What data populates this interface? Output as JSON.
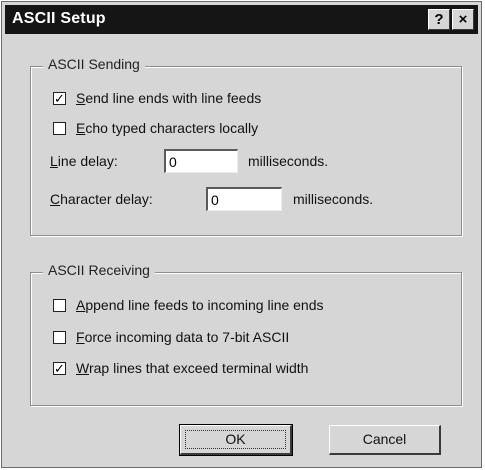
{
  "window": {
    "title": "ASCII Setup",
    "help_glyph": "?",
    "close_glyph": "×"
  },
  "sending": {
    "legend": "ASCII Sending",
    "line_feeds": {
      "hotkey": "S",
      "label_rest": "end line ends with line feeds",
      "checked": true
    },
    "echo": {
      "hotkey": "E",
      "label_rest": "cho typed characters locally",
      "checked": false
    },
    "line_delay": {
      "hotkey": "L",
      "label_rest": "ine delay:",
      "value": "0",
      "unit": "milliseconds."
    },
    "char_delay": {
      "hotkey": "C",
      "label_rest": "haracter delay:",
      "value": "0",
      "unit": "milliseconds."
    }
  },
  "receiving": {
    "legend": "ASCII Receiving",
    "append": {
      "hotkey": "A",
      "label_rest": "ppend line feeds to incoming line ends",
      "checked": false
    },
    "force7bit": {
      "hotkey": "F",
      "label_rest": "orce incoming data to 7-bit ASCII",
      "checked": false
    },
    "wrap": {
      "hotkey": "W",
      "label_rest": "rap lines that exceed terminal width",
      "checked": true
    }
  },
  "buttons": {
    "ok": "OK",
    "cancel": "Cancel"
  },
  "check_glyph": "✓"
}
